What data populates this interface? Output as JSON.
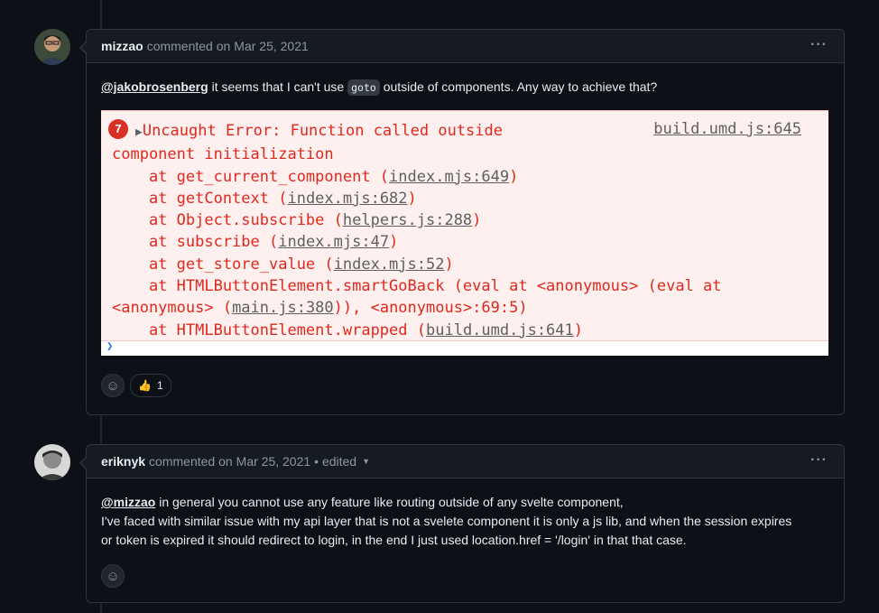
{
  "comments": [
    {
      "author": "mizzao",
      "action": "commented on",
      "date": "Mar 25, 2021",
      "edited": "",
      "menu": "···",
      "body": {
        "mention": "@jakobrosenberg",
        "text1": " it seems that I can't use ",
        "code": "goto",
        "text2": " outside of components. Any way to achieve that?"
      },
      "screenshot": {
        "badge": "7",
        "source": "build.umd.js:645",
        "error_line1": "Uncaught Error: Function called outside",
        "error_line2": "component initialization",
        "stack": [
          {
            "prefix": "    at get_current_component (",
            "file": "index.mjs:649",
            "suffix": ")"
          },
          {
            "prefix": "    at getContext (",
            "file": "index.mjs:682",
            "suffix": ")"
          },
          {
            "prefix": "    at Object.subscribe (",
            "file": "helpers.js:288",
            "suffix": ")"
          },
          {
            "prefix": "    at subscribe (",
            "file": "index.mjs:47",
            "suffix": ")"
          },
          {
            "prefix": "    at get_store_value (",
            "file": "index.mjs:52",
            "suffix": ")"
          },
          {
            "prefix": "    at HTMLButtonElement.smartGoBack (eval at <anonymous> (eval at",
            "file": "",
            "suffix": ""
          },
          {
            "prefix": "<anonymous> (",
            "file": "main.js:380",
            "suffix": ")), <anonymous>:69:5)"
          },
          {
            "prefix": "    at HTMLButtonElement.wrapped (",
            "file": "build.umd.js:641",
            "suffix": ")"
          }
        ]
      },
      "reactions": [
        {
          "emoji": "👍",
          "count": "1"
        }
      ]
    },
    {
      "author": "eriknyk",
      "action": "commented on",
      "date": "Mar 25, 2021",
      "edited": "• edited",
      "menu": "···",
      "body": {
        "mention": "@mizzao",
        "line1": " in general you cannot use any feature like routing outside of any svelte component,",
        "line2": "I've faced with similar issue with my api layer that is not a svelete component it is only a js lib, and when the session expires",
        "line3": "or token is expired it should redirect to login, in the end I just used location.href = '/login' in that that case."
      },
      "reactions": []
    }
  ],
  "icons": {
    "smiley": "smiley-icon",
    "kebab": "kebab-horizontal-icon",
    "caret": "triangle-down-icon"
  }
}
